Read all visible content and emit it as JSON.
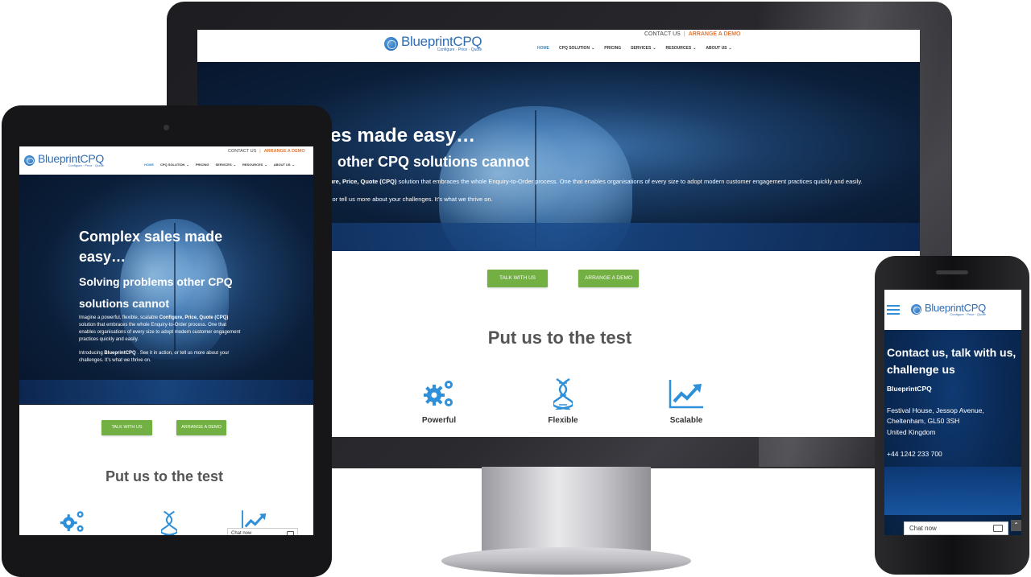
{
  "brand": {
    "name": "BlueprintCPQ",
    "tagline": "Configure · Price · Quote"
  },
  "topbar": {
    "contact": "CONTACT US",
    "separator": "|",
    "demo": "ARRANGE A DEMO"
  },
  "nav": {
    "items": [
      {
        "label": "HOME"
      },
      {
        "label": "CPQ SOLUTION"
      },
      {
        "label": "PRICING"
      },
      {
        "label": "SERVICES"
      },
      {
        "label": "RESOURCES"
      },
      {
        "label": "ABOUT US"
      }
    ],
    "caret": "⌄"
  },
  "desktop": {
    "hero_title": "es made easy…",
    "hero_subtitle": "other CPQ solutions cannot",
    "hero_text_lead": "figure, Price, Quote (CPQ)",
    "hero_text_rest": " solution that embraces the whole Enquiry-to-Order process. One that enables organisations of every size to adopt modern customer engagement practices quickly and easily.",
    "hero_text2": "on, or tell us more about your challenges. It’s what we thrive on."
  },
  "tablet": {
    "hero_title": "Complex sales made easy…",
    "hero_subtitle": "Solving problems other CPQ solutions cannot",
    "intro_a": "Imagine a powerful, flexible, scalable ",
    "intro_bold": "Configure, Price, Quote (CPQ)",
    "intro_b": " solution that embraces the whole Enquiry-to-Order process. One that enables organisations of every size to adopt modern customer engagement practices quickly and easily.",
    "intro2_a": "Introducing ",
    "intro2_bold": "BlueprintCPQ",
    "intro2_b": " . See it in action, or tell us more about your challenges. It’s what we thrive on."
  },
  "buttons": {
    "talk": "TALK WITH US",
    "demo": "ARRANGE A DEMO"
  },
  "section": {
    "title": "Put us to the test"
  },
  "features": [
    {
      "label": "Powerful",
      "icon": "gears-icon"
    },
    {
      "label": "Flexible",
      "icon": "dna-icon"
    },
    {
      "label": "Scalable",
      "icon": "growth-chart-icon"
    }
  ],
  "chat": {
    "label": "Chat now"
  },
  "phone": {
    "heading": "Contact us, talk with us, challenge us",
    "company": "BlueprintCPQ",
    "address_1": "Festival House, Jessop Avenue,",
    "address_2": "Cheltenham, GL50 3SH",
    "address_3": "United Kingdom",
    "phone": "+44 1242 233 700"
  },
  "colors": {
    "brand_blue": "#2f6db5",
    "accent_orange": "#e07a3a",
    "button_green": "#73b043",
    "hero_navy": "#0b1f3a"
  }
}
